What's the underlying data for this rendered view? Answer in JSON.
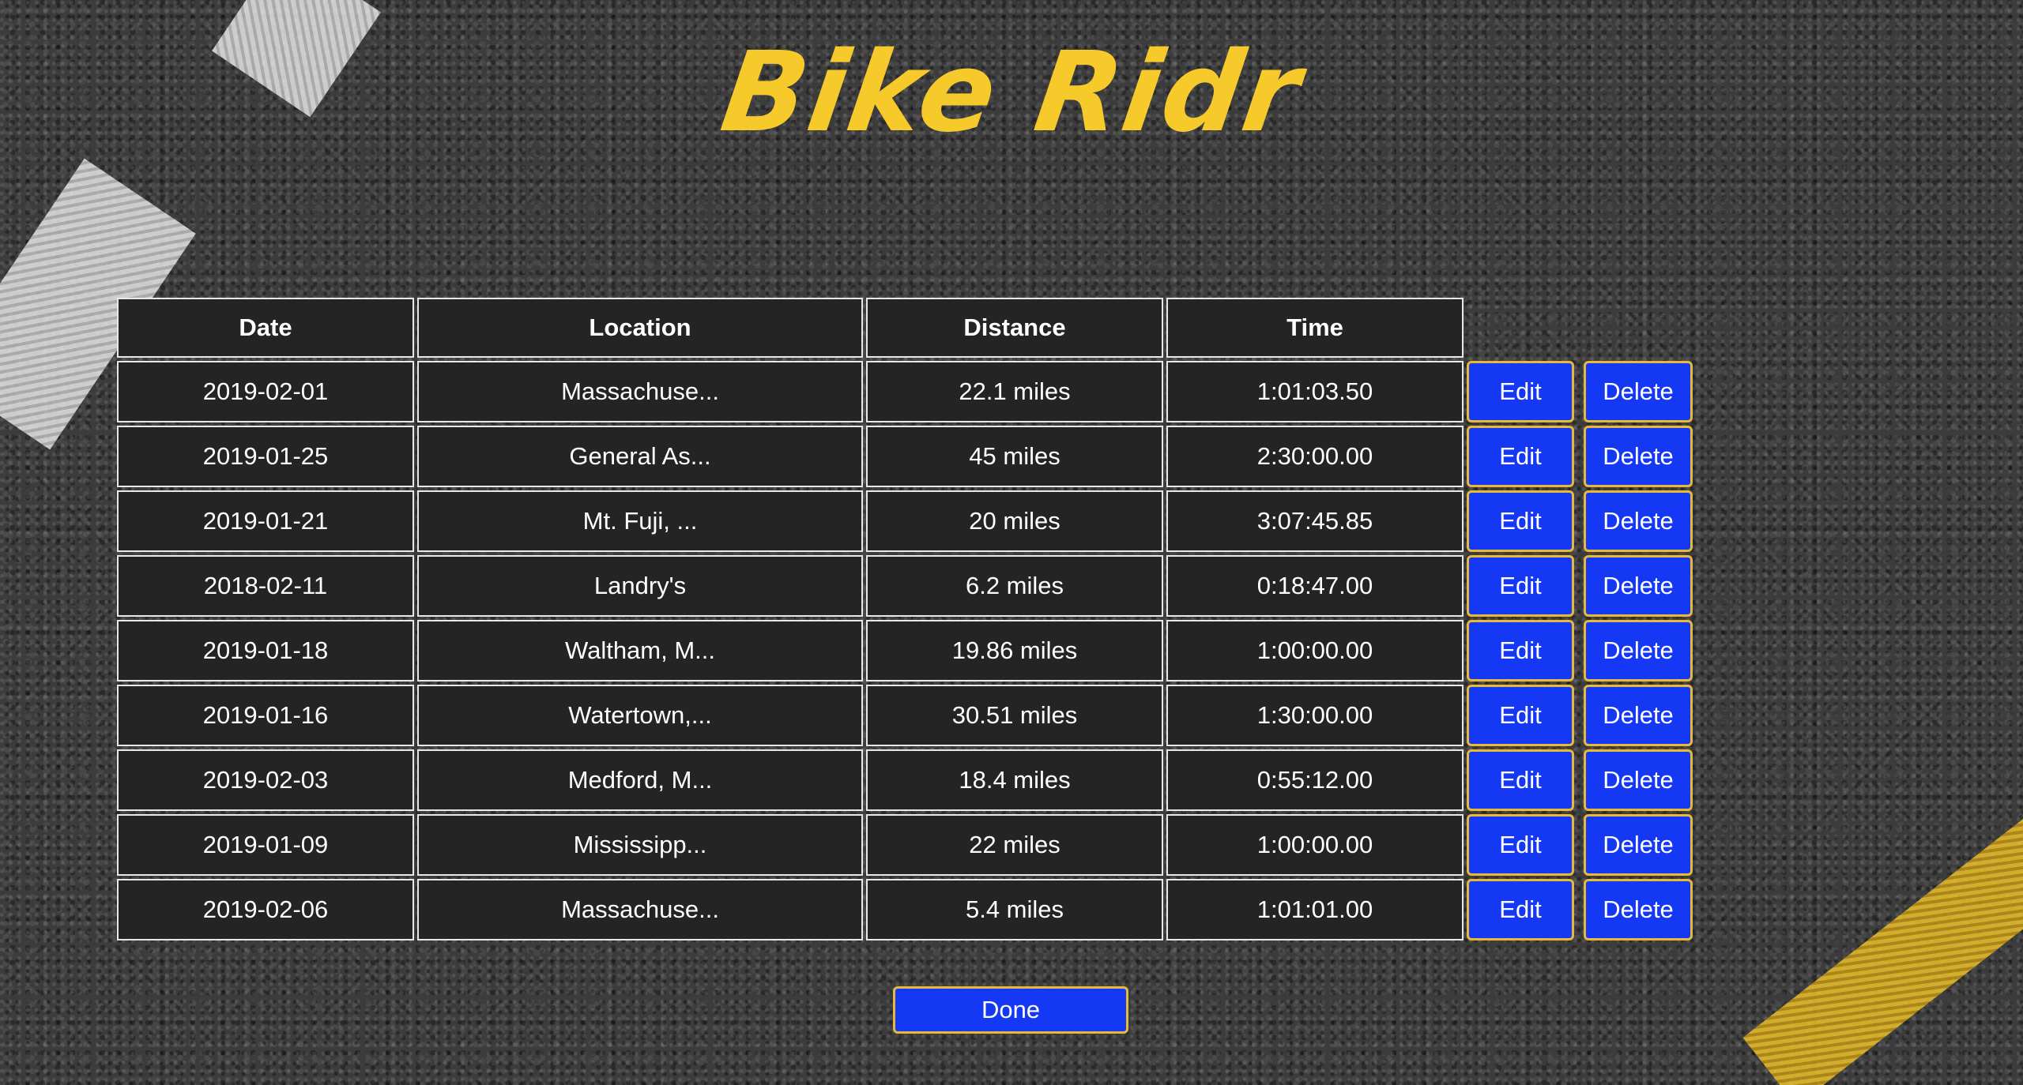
{
  "app": {
    "title": "Bike Ridr"
  },
  "table": {
    "headers": [
      "Date",
      "Location",
      "Distance",
      "Time"
    ],
    "rows": [
      {
        "date": "2019-02-01",
        "location": "Massachuse...",
        "distance": "22.1 miles",
        "time": "1:01:03.50"
      },
      {
        "date": "2019-01-25",
        "location": "General As...",
        "distance": "45 miles",
        "time": "2:30:00.00"
      },
      {
        "date": "2019-01-21",
        "location": "Mt. Fuji, ...",
        "distance": "20 miles",
        "time": "3:07:45.85"
      },
      {
        "date": "2018-02-11",
        "location": "Landry's",
        "distance": "6.2 miles",
        "time": "0:18:47.00"
      },
      {
        "date": "2019-01-18",
        "location": "Waltham, M...",
        "distance": "19.86 miles",
        "time": "1:00:00.00"
      },
      {
        "date": "2019-01-16",
        "location": "Watertown,...",
        "distance": "30.51 miles",
        "time": "1:30:00.00"
      },
      {
        "date": "2019-02-03",
        "location": "Medford, M...",
        "distance": "18.4 miles",
        "time": "0:55:12.00"
      },
      {
        "date": "2019-01-09",
        "location": "Mississipp...",
        "distance": "22 miles",
        "time": "1:00:00.00"
      },
      {
        "date": "2019-02-06",
        "location": "Massachuse...",
        "distance": "5.4 miles",
        "time": "1:01:01.00"
      }
    ],
    "edit_label": "Edit",
    "delete_label": "Delete"
  },
  "footer": {
    "done_label": "Done"
  },
  "colors": {
    "title": "#f6ca2b",
    "button_bg": "#1438f4",
    "button_border": "#e6b93a",
    "cell_bg": "#242424"
  }
}
